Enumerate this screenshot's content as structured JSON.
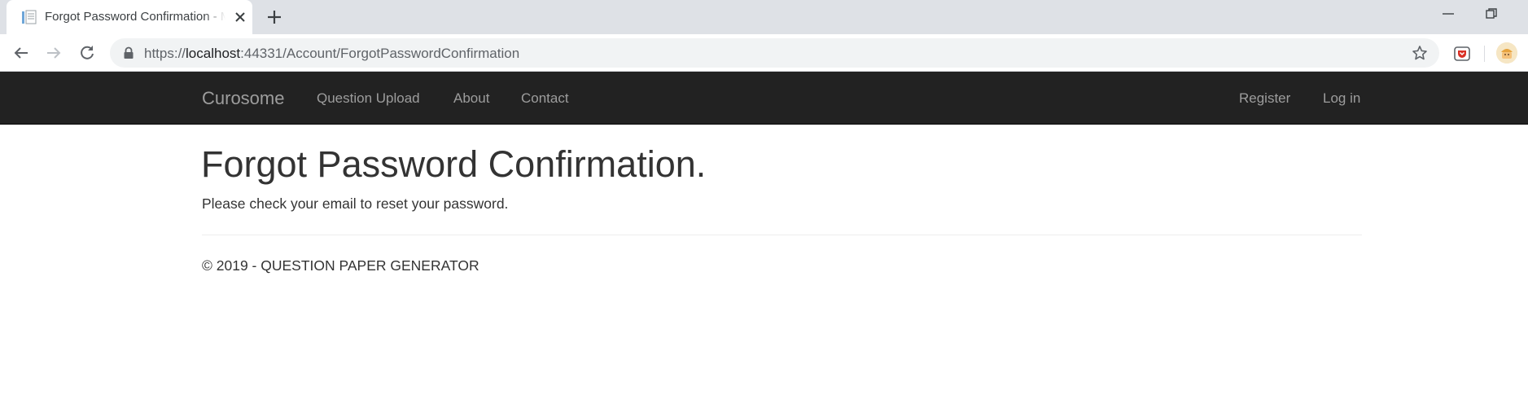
{
  "browser": {
    "tab_title": "Forgot Password Confirmation - M",
    "url_scheme": "https://",
    "url_host": "localhost",
    "url_rest": ":44331/Account/ForgotPasswordConfirmation"
  },
  "navbar": {
    "brand": "Curosome",
    "links": [
      "Question Upload",
      "About",
      "Contact"
    ],
    "right_links": [
      "Register",
      "Log in"
    ]
  },
  "main": {
    "title": "Forgot Password Confirmation.",
    "message": "Please check your email to reset your password."
  },
  "footer": {
    "text": "© 2019 - QUESTION PAPER GENERATOR"
  },
  "colors": {
    "navbar_bg": "#222222",
    "nav_link": "#9d9d9d",
    "text": "#333333",
    "tabstrip": "#dee1e6"
  }
}
